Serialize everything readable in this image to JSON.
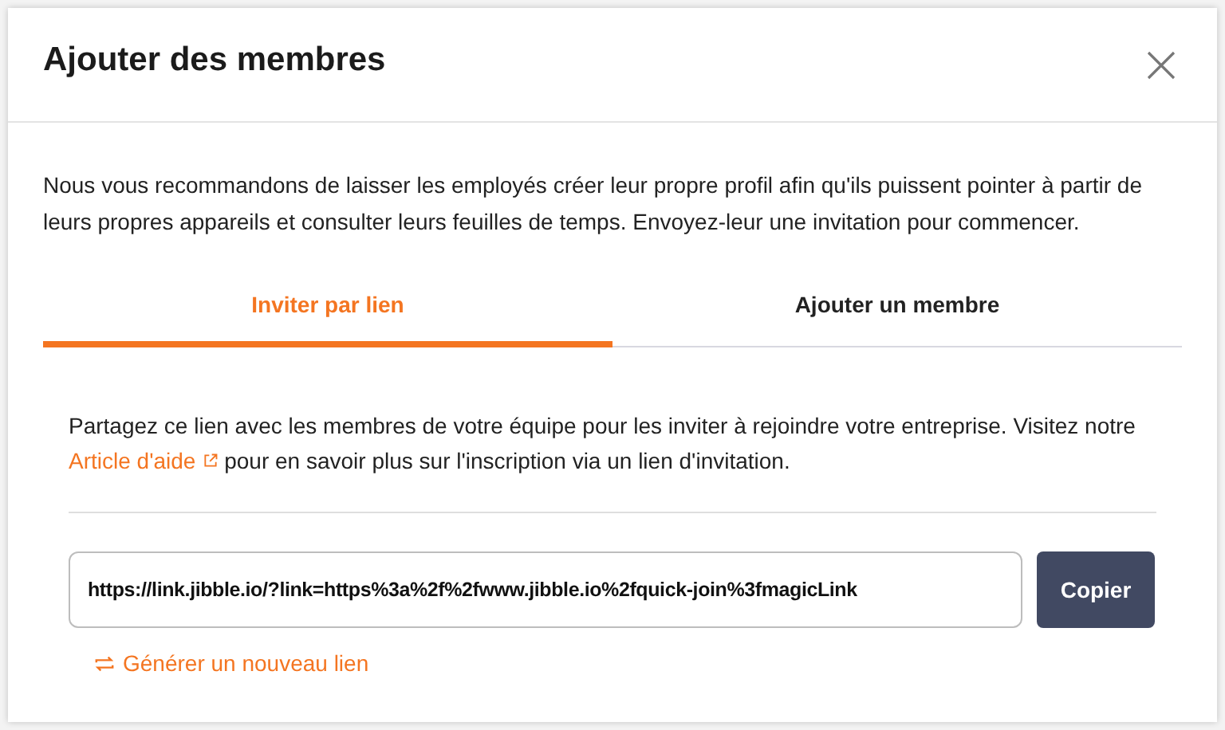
{
  "dialog": {
    "title": "Ajouter des membres"
  },
  "intro": "Nous vous recommandons de laisser les employés créer leur propre profil afin qu'ils puissent pointer à partir de leurs propres appareils et consulter leurs feuilles de temps. Envoyez-leur une invitation pour commencer.",
  "tabs": [
    {
      "label": "Inviter par lien",
      "selected": true
    },
    {
      "label": "Ajouter un membre",
      "selected": false
    }
  ],
  "share": {
    "text_before": "Partagez ce lien avec les membres de votre équipe pour les inviter à rejoindre votre entreprise. Visitez notre",
    "link": "Article d'aide",
    "text_after": "pour en savoir plus sur l'inscription via un lien d'invitation."
  },
  "invite_link": {
    "value": "https://link.jibble.io/?link=https%3a%2f%2fwww.jibble.io%2fquick-join%3fmagicLink",
    "button": "Copier"
  },
  "regenerate": "Générer un nouveau lien"
}
